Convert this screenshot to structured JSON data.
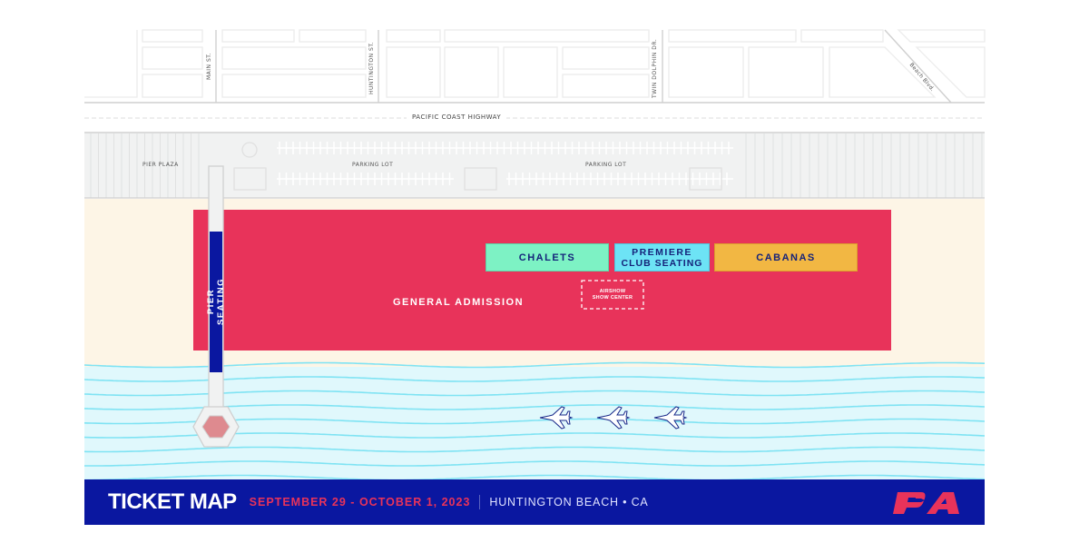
{
  "streets": {
    "main": "MAIN ST.",
    "huntington": "HUNTINGTON ST.",
    "twin_dolphin": "TWIN DOLPHIN DR.",
    "beach_blvd": "Beach Blvd.",
    "pch": "PACIFIC COAST HIGHWAY"
  },
  "areas": {
    "pier_plaza": "PIER PLAZA",
    "parking_lot_1": "PARKING LOT",
    "parking_lot_2": "PARKING LOT"
  },
  "zones": {
    "general_admission": "GENERAL ADMISSION",
    "pier_seating": "PIER SEATING",
    "chalets": "CHALETS",
    "premiere_line1": "PREMIERE",
    "premiere_line2": "CLUB SEATING",
    "cabanas": "CABANAS",
    "airshow_line1": "AIRSHOW",
    "airshow_line2": "SHOW CENTER"
  },
  "colors": {
    "general_admission": "#e8335a",
    "pier_seating": "#0a17a0",
    "chalets": "#7df2c4",
    "premiere": "#6de3f5",
    "cabanas": "#f2b743",
    "sand": "#fdf5e6",
    "water": "#e0f8fc",
    "footer": "#0a17a0"
  },
  "footer": {
    "title": "TICKET MAP",
    "dates": "SEPTEMBER 29 - OCTOBER 1, 2023",
    "location": "HUNTINGTON BEACH • CA",
    "logo_text": "PA"
  },
  "icons": [
    "jet-icon",
    "jet-icon",
    "jet-icon",
    "pier-hexagon-icon",
    "pa-logo"
  ]
}
